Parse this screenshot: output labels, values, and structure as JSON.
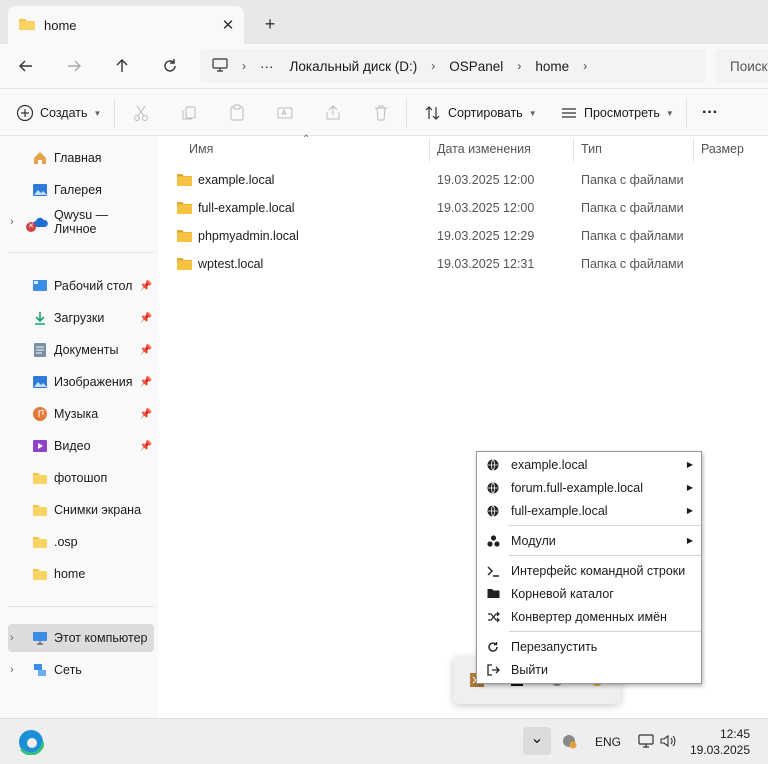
{
  "window": {
    "tab_title": "home",
    "close_glyph": "✕",
    "new_tab_glyph": "+"
  },
  "address": {
    "more": "···",
    "crumbs": [
      "Локальный диск (D:)",
      "OSPanel",
      "home"
    ],
    "search_placeholder": "Поиск"
  },
  "toolbar": {
    "create": "Создать",
    "sort": "Сортировать",
    "view": "Просмотреть",
    "more": "···"
  },
  "sidebar": {
    "top": [
      {
        "label": "Главная",
        "icon": "home-icon"
      },
      {
        "label": "Галерея",
        "icon": "gallery-icon"
      },
      {
        "label": "Qwysu — Личное",
        "icon": "onedrive-icon"
      }
    ],
    "quick": [
      {
        "label": "Рабочий стол",
        "icon": "desktop-icon",
        "pinned": true
      },
      {
        "label": "Загрузки",
        "icon": "downloads-icon",
        "pinned": true
      },
      {
        "label": "Документы",
        "icon": "documents-icon",
        "pinned": true
      },
      {
        "label": "Изображения",
        "icon": "pictures-icon",
        "pinned": true
      },
      {
        "label": "Музыка",
        "icon": "music-icon",
        "pinned": true
      },
      {
        "label": "Видео",
        "icon": "videos-icon",
        "pinned": true
      },
      {
        "label": "фотошоп",
        "icon": "folder-icon",
        "pinned": false
      },
      {
        "label": "Снимки экрана",
        "icon": "folder-icon",
        "pinned": false
      },
      {
        "label": ".osp",
        "icon": "folder-icon",
        "pinned": false
      },
      {
        "label": "home",
        "icon": "folder-icon",
        "pinned": false
      }
    ],
    "bottom": [
      {
        "label": "Этот компьютер",
        "icon": "computer-icon",
        "selected": true
      },
      {
        "label": "Сеть",
        "icon": "network-icon",
        "selected": false
      }
    ]
  },
  "columns": {
    "name": "Имя",
    "date": "Дата изменения",
    "type": "Тип",
    "size": "Размер"
  },
  "files": [
    {
      "name": "example.local",
      "date": "19.03.2025 12:00",
      "type": "Папка с файлами"
    },
    {
      "name": "full-example.local",
      "date": "19.03.2025 12:00",
      "type": "Папка с файлами"
    },
    {
      "name": "phpmyadmin.local",
      "date": "19.03.2025 12:29",
      "type": "Папка с файлами"
    },
    {
      "name": "wptest.local",
      "date": "19.03.2025 12:31",
      "type": "Папка с файлами"
    }
  ],
  "context_menu": {
    "items": [
      {
        "label": "example.local",
        "icon": "globe-icon",
        "submenu": true
      },
      {
        "label": "forum.full-example.local",
        "icon": "globe-icon",
        "submenu": true
      },
      {
        "label": "full-example.local",
        "icon": "globe-icon",
        "submenu": true
      },
      {
        "label": "Модули",
        "icon": "modules-icon",
        "submenu": true
      },
      {
        "label": "Интерфейс командной строки",
        "icon": "terminal-icon",
        "submenu": false
      },
      {
        "label": "Корневой каталог",
        "icon": "folder-icon",
        "submenu": false
      },
      {
        "label": "Конвертер доменных имён",
        "icon": "shuffle-icon",
        "submenu": false
      },
      {
        "label": "Перезапустить",
        "icon": "restart-icon",
        "submenu": false
      },
      {
        "label": "Выйти",
        "icon": "exit-icon",
        "submenu": false
      }
    ]
  },
  "taskbar": {
    "lang": "ENG",
    "time": "12:45",
    "date": "19.03.2025",
    "chevron": "⌄"
  },
  "colors": {
    "folder": "#f5c242",
    "accent": "#0067c0",
    "selected": "#dcdcdc"
  }
}
